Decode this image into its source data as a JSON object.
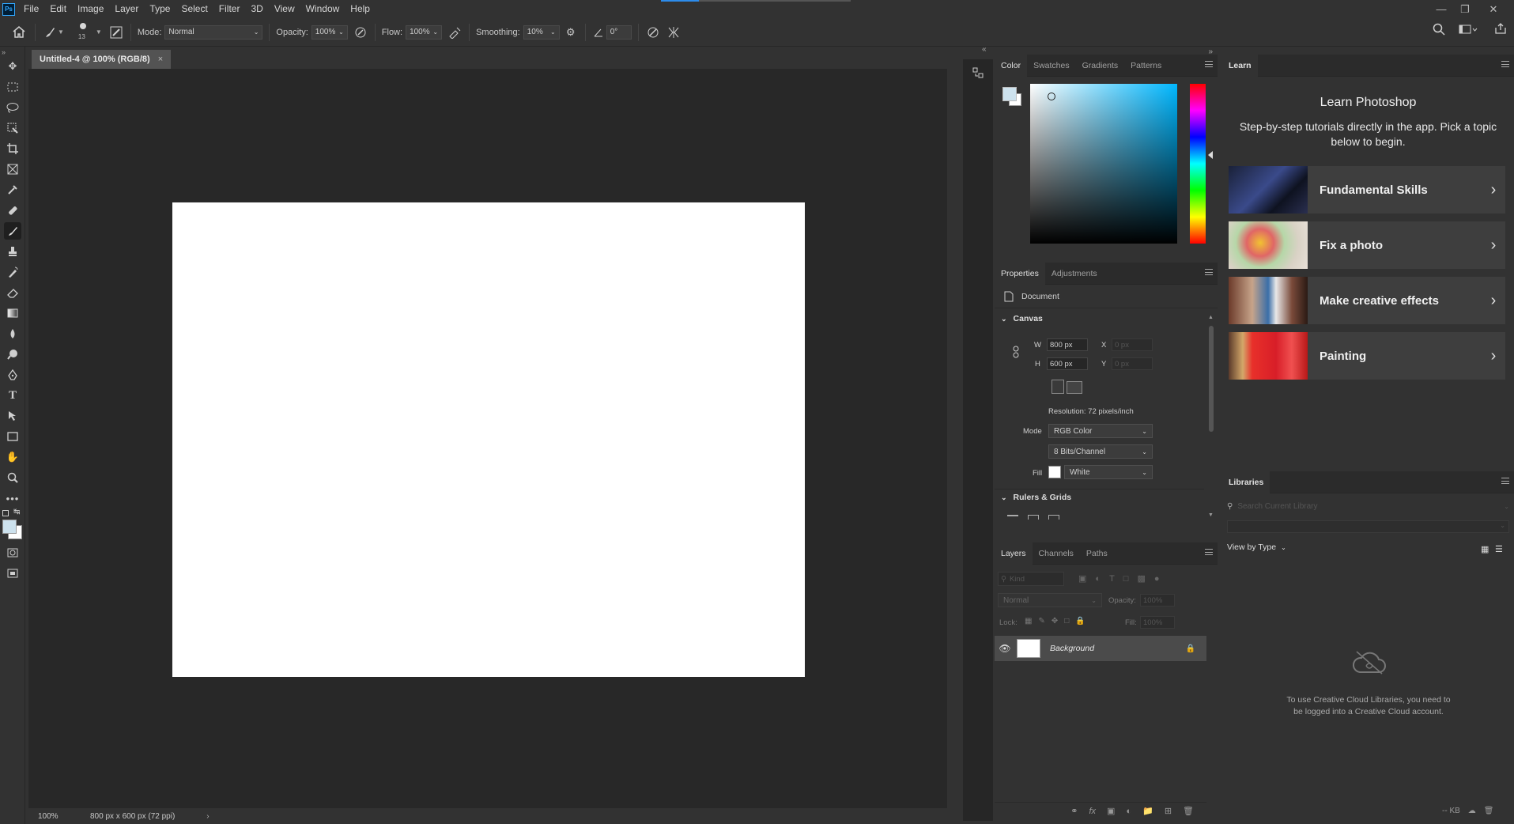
{
  "menu": {
    "logo": "Ps",
    "items": [
      "File",
      "Edit",
      "Image",
      "Layer",
      "Type",
      "Select",
      "Filter",
      "3D",
      "View",
      "Window",
      "Help"
    ]
  },
  "options": {
    "brush_size": "13",
    "mode_label": "Mode:",
    "mode_value": "Normal",
    "opacity_label": "Opacity:",
    "opacity_value": "100%",
    "flow_label": "Flow:",
    "flow_value": "100%",
    "smoothing_label": "Smoothing:",
    "smoothing_value": "10%",
    "angle_value": "0°"
  },
  "document": {
    "tab_title": "Untitled-4 @ 100% (RGB/8)",
    "zoom": "100%",
    "status": "800 px x 600 px (72 ppi)"
  },
  "color_panel": {
    "tabs": [
      "Color",
      "Swatches",
      "Gradients",
      "Patterns"
    ],
    "fg_color": "#cde2ee",
    "bg_color": "#ffffff"
  },
  "properties": {
    "tabs": [
      "Properties",
      "Adjustments"
    ],
    "doc_label": "Document",
    "canvas_section": "Canvas",
    "w_label": "W",
    "w_value": "800 px",
    "h_label": "H",
    "h_value": "600 px",
    "x_label": "X",
    "x_value": "0 px",
    "y_label": "Y",
    "y_value": "0 px",
    "resolution": "Resolution: 72 pixels/inch",
    "mode_label": "Mode",
    "mode_value": "RGB Color",
    "bits_value": "8 Bits/Channel",
    "fill_label": "Fill",
    "fill_value": "White",
    "rulers_section": "Rulers & Grids"
  },
  "layers": {
    "tabs": [
      "Layers",
      "Channels",
      "Paths"
    ],
    "kind_placeholder": "Kind",
    "blend_value": "Normal",
    "opacity_label": "Opacity:",
    "opacity_value": "100%",
    "lock_label": "Lock:",
    "fill_label": "Fill:",
    "fill_value": "100%",
    "items": [
      {
        "name": "Background"
      }
    ]
  },
  "learn": {
    "tab": "Learn",
    "title": "Learn Photoshop",
    "subtitle": "Step-by-step tutorials directly in the app. Pick a topic below to begin.",
    "cards": [
      {
        "label": "Fundamental Skills"
      },
      {
        "label": "Fix a photo"
      },
      {
        "label": "Make creative effects"
      },
      {
        "label": "Painting"
      }
    ]
  },
  "libraries": {
    "tab": "Libraries",
    "search_placeholder": "Search Current Library",
    "view_by": "View by Type",
    "message": "To use Creative Cloud Libraries, you need to be logged into a Creative Cloud account.",
    "storage": "-- KB"
  }
}
